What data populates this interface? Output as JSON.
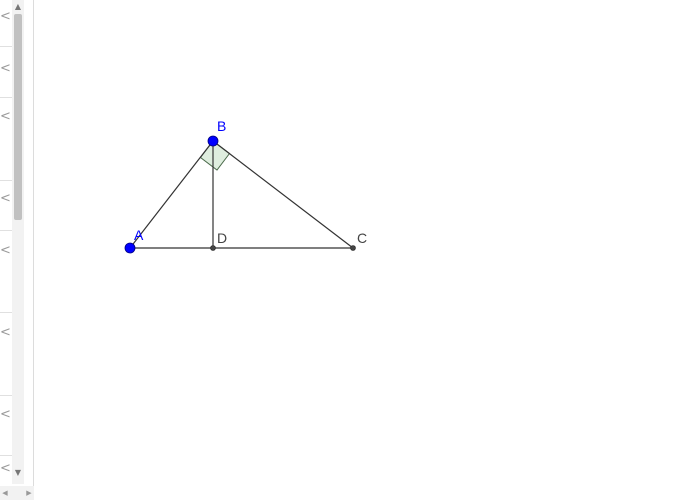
{
  "algebra_panel": {
    "row_toggles": [
      "<",
      "<",
      "<",
      "<",
      "<",
      "<",
      "<",
      "<"
    ],
    "scroll_up": "▲",
    "scroll_down": "▼",
    "scroll_left": "◀",
    "scroll_right": "▶"
  },
  "graphics": {
    "points": {
      "A": {
        "label": "A",
        "color": "#0000ff",
        "free": true
      },
      "B": {
        "label": "B",
        "color": "#0000ff",
        "free": true
      },
      "C": {
        "label": "C",
        "color": "#444444",
        "free": false
      },
      "D": {
        "label": "D",
        "color": "#444444",
        "free": false
      }
    },
    "segments": [
      "AB",
      "BC",
      "AC",
      "BD"
    ],
    "right_angle_at": "B",
    "colors": {
      "segment": "#333333",
      "angle_fill": "#dfeedf",
      "angle_stroke": "#4a6a4a",
      "free_point": "#0000ff",
      "dependent_point": "#444444"
    }
  }
}
